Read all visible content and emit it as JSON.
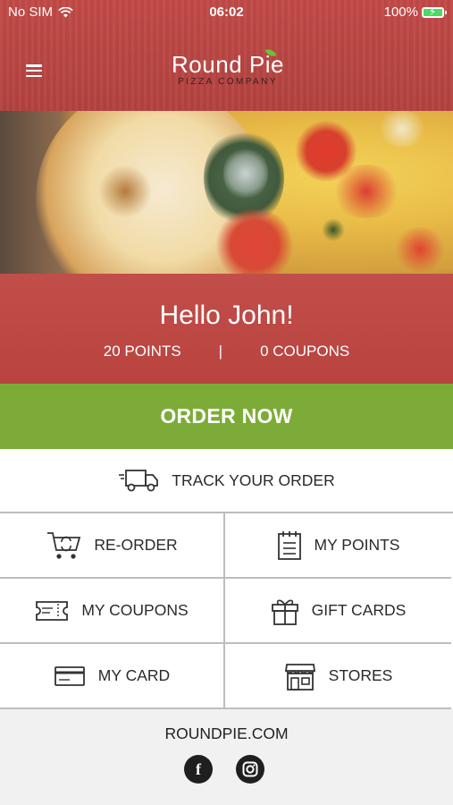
{
  "status_bar": {
    "carrier": "No SIM",
    "time": "06:02",
    "battery": "100%"
  },
  "header": {
    "logo_main": "Round Pie",
    "logo_sub": "PIZZA COMPANY",
    "menu_icon": "hamburger-icon"
  },
  "greeting": {
    "title": "Hello John!",
    "points": "20 POINTS",
    "separator": "|",
    "coupons": "0 COUPONS"
  },
  "order_now": {
    "label": "ORDER NOW"
  },
  "menu": {
    "track": {
      "label": "TRACK YOUR ORDER",
      "icon": "delivery-truck-icon"
    },
    "reorder": {
      "label": "RE-ORDER",
      "icon": "cart-refresh-icon"
    },
    "points": {
      "label": "MY POINTS",
      "icon": "notepad-icon"
    },
    "coupons": {
      "label": "MY COUPONS",
      "icon": "ticket-icon"
    },
    "gift_cards": {
      "label": "GIFT CARDS",
      "icon": "gift-icon"
    },
    "card": {
      "label": "MY CARD",
      "icon": "credit-card-icon"
    },
    "stores": {
      "label": "STORES",
      "icon": "storefront-icon"
    }
  },
  "footer": {
    "site": "ROUNDPIE.COM",
    "facebook_glyph": "f",
    "social": [
      "facebook-icon",
      "instagram-icon"
    ]
  },
  "colors": {
    "brand_red": "#b94643",
    "order_green": "#7cac37",
    "divider": "#bdbdbd"
  }
}
